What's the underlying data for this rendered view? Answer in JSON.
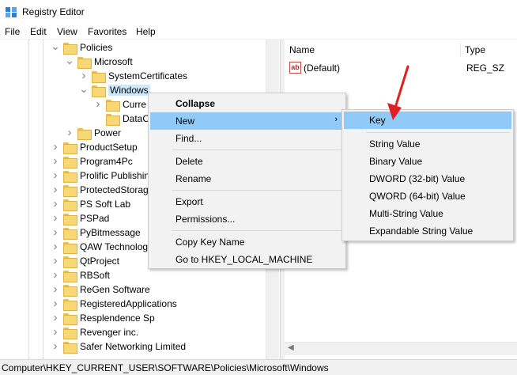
{
  "window": {
    "title": "Registry Editor"
  },
  "menubar": [
    "File",
    "Edit",
    "View",
    "Favorites",
    "Help"
  ],
  "tree": {
    "items": [
      {
        "label": "Policies",
        "chev": "down"
      },
      {
        "label": "Microsoft",
        "chev": "down"
      },
      {
        "label": "SystemCertificates",
        "chev": "right"
      },
      {
        "label": "Windows",
        "chev": "down",
        "selected": true
      },
      {
        "label": "Curre",
        "chev": "right"
      },
      {
        "label": "DataC",
        "chev": ""
      },
      {
        "label": "Power",
        "chev": "right"
      },
      {
        "label": "ProductSetup",
        "chev": "right"
      },
      {
        "label": "Program4Pc",
        "chev": "right"
      },
      {
        "label": "Prolific Publishin",
        "chev": "right"
      },
      {
        "label": "ProtectedStorag",
        "chev": "right"
      },
      {
        "label": "PS Soft Lab",
        "chev": "right"
      },
      {
        "label": "PSPad",
        "chev": "right"
      },
      {
        "label": "PyBitmessage",
        "chev": "right"
      },
      {
        "label": "QAW Technolog",
        "chev": "right"
      },
      {
        "label": "QtProject",
        "chev": "right"
      },
      {
        "label": "RBSoft",
        "chev": "right"
      },
      {
        "label": "ReGen Software",
        "chev": "right"
      },
      {
        "label": "RegisteredApplications",
        "chev": "right"
      },
      {
        "label": "Resplendence Sp",
        "chev": "right"
      },
      {
        "label": "Revenger inc.",
        "chev": "right"
      },
      {
        "label": "Safer Networking Limited",
        "chev": "right"
      }
    ]
  },
  "values_pane": {
    "columns": {
      "name": "Name",
      "type": "Type"
    },
    "rows": [
      {
        "icon": "ab",
        "name": "(Default)",
        "type": "REG_SZ"
      }
    ]
  },
  "context_menu": {
    "items": [
      {
        "label": "Collapse",
        "bold": true
      },
      {
        "label": "New",
        "highlighted": true,
        "submenu": true
      },
      {
        "label": "Find..."
      },
      {
        "label": "Delete"
      },
      {
        "label": "Rename"
      },
      {
        "label": "Export"
      },
      {
        "label": "Permissions..."
      },
      {
        "label": "Copy Key Name"
      },
      {
        "label": "Go to HKEY_LOCAL_MACHINE"
      }
    ]
  },
  "new_submenu": {
    "items": [
      {
        "label": "Key",
        "highlighted": true
      },
      {
        "label": "String Value"
      },
      {
        "label": "Binary Value"
      },
      {
        "label": "DWORD (32-bit) Value"
      },
      {
        "label": "QWORD (64-bit) Value"
      },
      {
        "label": "Multi-String Value"
      },
      {
        "label": "Expandable String Value"
      }
    ]
  },
  "statusbar": {
    "path": "Computer\\HKEY_CURRENT_USER\\SOFTWARE\\Policies\\Microsoft\\Windows"
  },
  "colors": {
    "highlight": "#91c9f7",
    "selection": "#cce8ff",
    "annotation_arrow": "#e02020",
    "folder": "#f8d775"
  },
  "icons": {
    "submenu_arrow": "chevron-right-icon",
    "expand": "chevron-right-icon",
    "collapse": "chevron-down-icon"
  }
}
